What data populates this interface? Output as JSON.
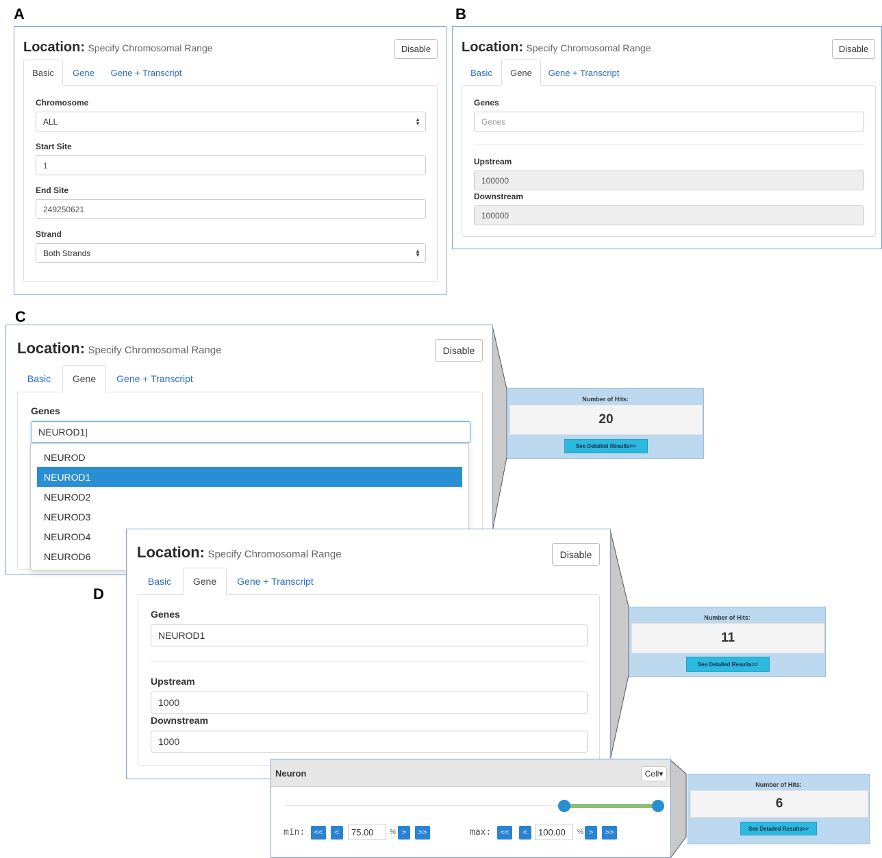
{
  "labels": {
    "a": "A",
    "b": "B",
    "c": "C",
    "d": "D"
  },
  "location": {
    "title_main": "Location:",
    "title_sub": "Specify Chromosomal Range",
    "disable": "Disable",
    "tabs": [
      "Basic",
      "Gene",
      "Gene + Transcript"
    ]
  },
  "panel_a": {
    "chromosome_label": "Chromosome",
    "chromosome_value": "ALL",
    "start_label": "Start Site",
    "start_value": "1",
    "end_label": "End Site",
    "end_value": "249250621",
    "strand_label": "Strand",
    "strand_value": "Both Strands"
  },
  "panel_b": {
    "genes_label": "Genes",
    "genes_placeholder": "Genes",
    "upstream_label": "Upstream",
    "upstream_value": "100000",
    "downstream_label": "Downstream",
    "downstream_value": "100000"
  },
  "panel_c": {
    "genes_label": "Genes",
    "genes_value": "NEUROD1",
    "suggestions": [
      "NEUROD",
      "NEUROD1",
      "NEUROD2",
      "NEUROD3",
      "NEUROD4",
      "NEUROD6"
    ],
    "selected_suggestion": "NEUROD1",
    "hits_title": "Number of Hits:",
    "hits_value": "20",
    "hits_button": "See Detailed Results>>"
  },
  "panel_d": {
    "genes_label": "Genes",
    "genes_value": "NEUROD1",
    "upstream_label": "Upstream",
    "upstream_value": "1000",
    "downstream_label": "Downstream",
    "downstream_value": "1000",
    "hits_title": "Number of Hits:",
    "hits_value": "11",
    "hits_button": "See Detailed Results>>"
  },
  "neuron": {
    "title": "Neuron",
    "cell_button": "Cell▾",
    "min_label": "min:",
    "max_label": "max:",
    "min_value": "75.00",
    "max_value": "100.00",
    "pct": "%",
    "btn_first": "<<",
    "btn_prev": "<",
    "btn_next": ">",
    "btn_last": ">>",
    "range_min_fraction": 0.75,
    "range_max_fraction": 1.0,
    "hits_title": "Number of Hits:",
    "hits_value": "6",
    "hits_button": "See Detailed Results>>"
  },
  "colors": {
    "panel_border": "#7ea1cc",
    "tab_link": "#2a6cc4",
    "selected_row": "#2a8fd2",
    "hits_bg": "#bcd8ef",
    "hits_button": "#2bb9de",
    "slider_handle": "#2a8fd2",
    "slider_range": "#8cc07a"
  }
}
